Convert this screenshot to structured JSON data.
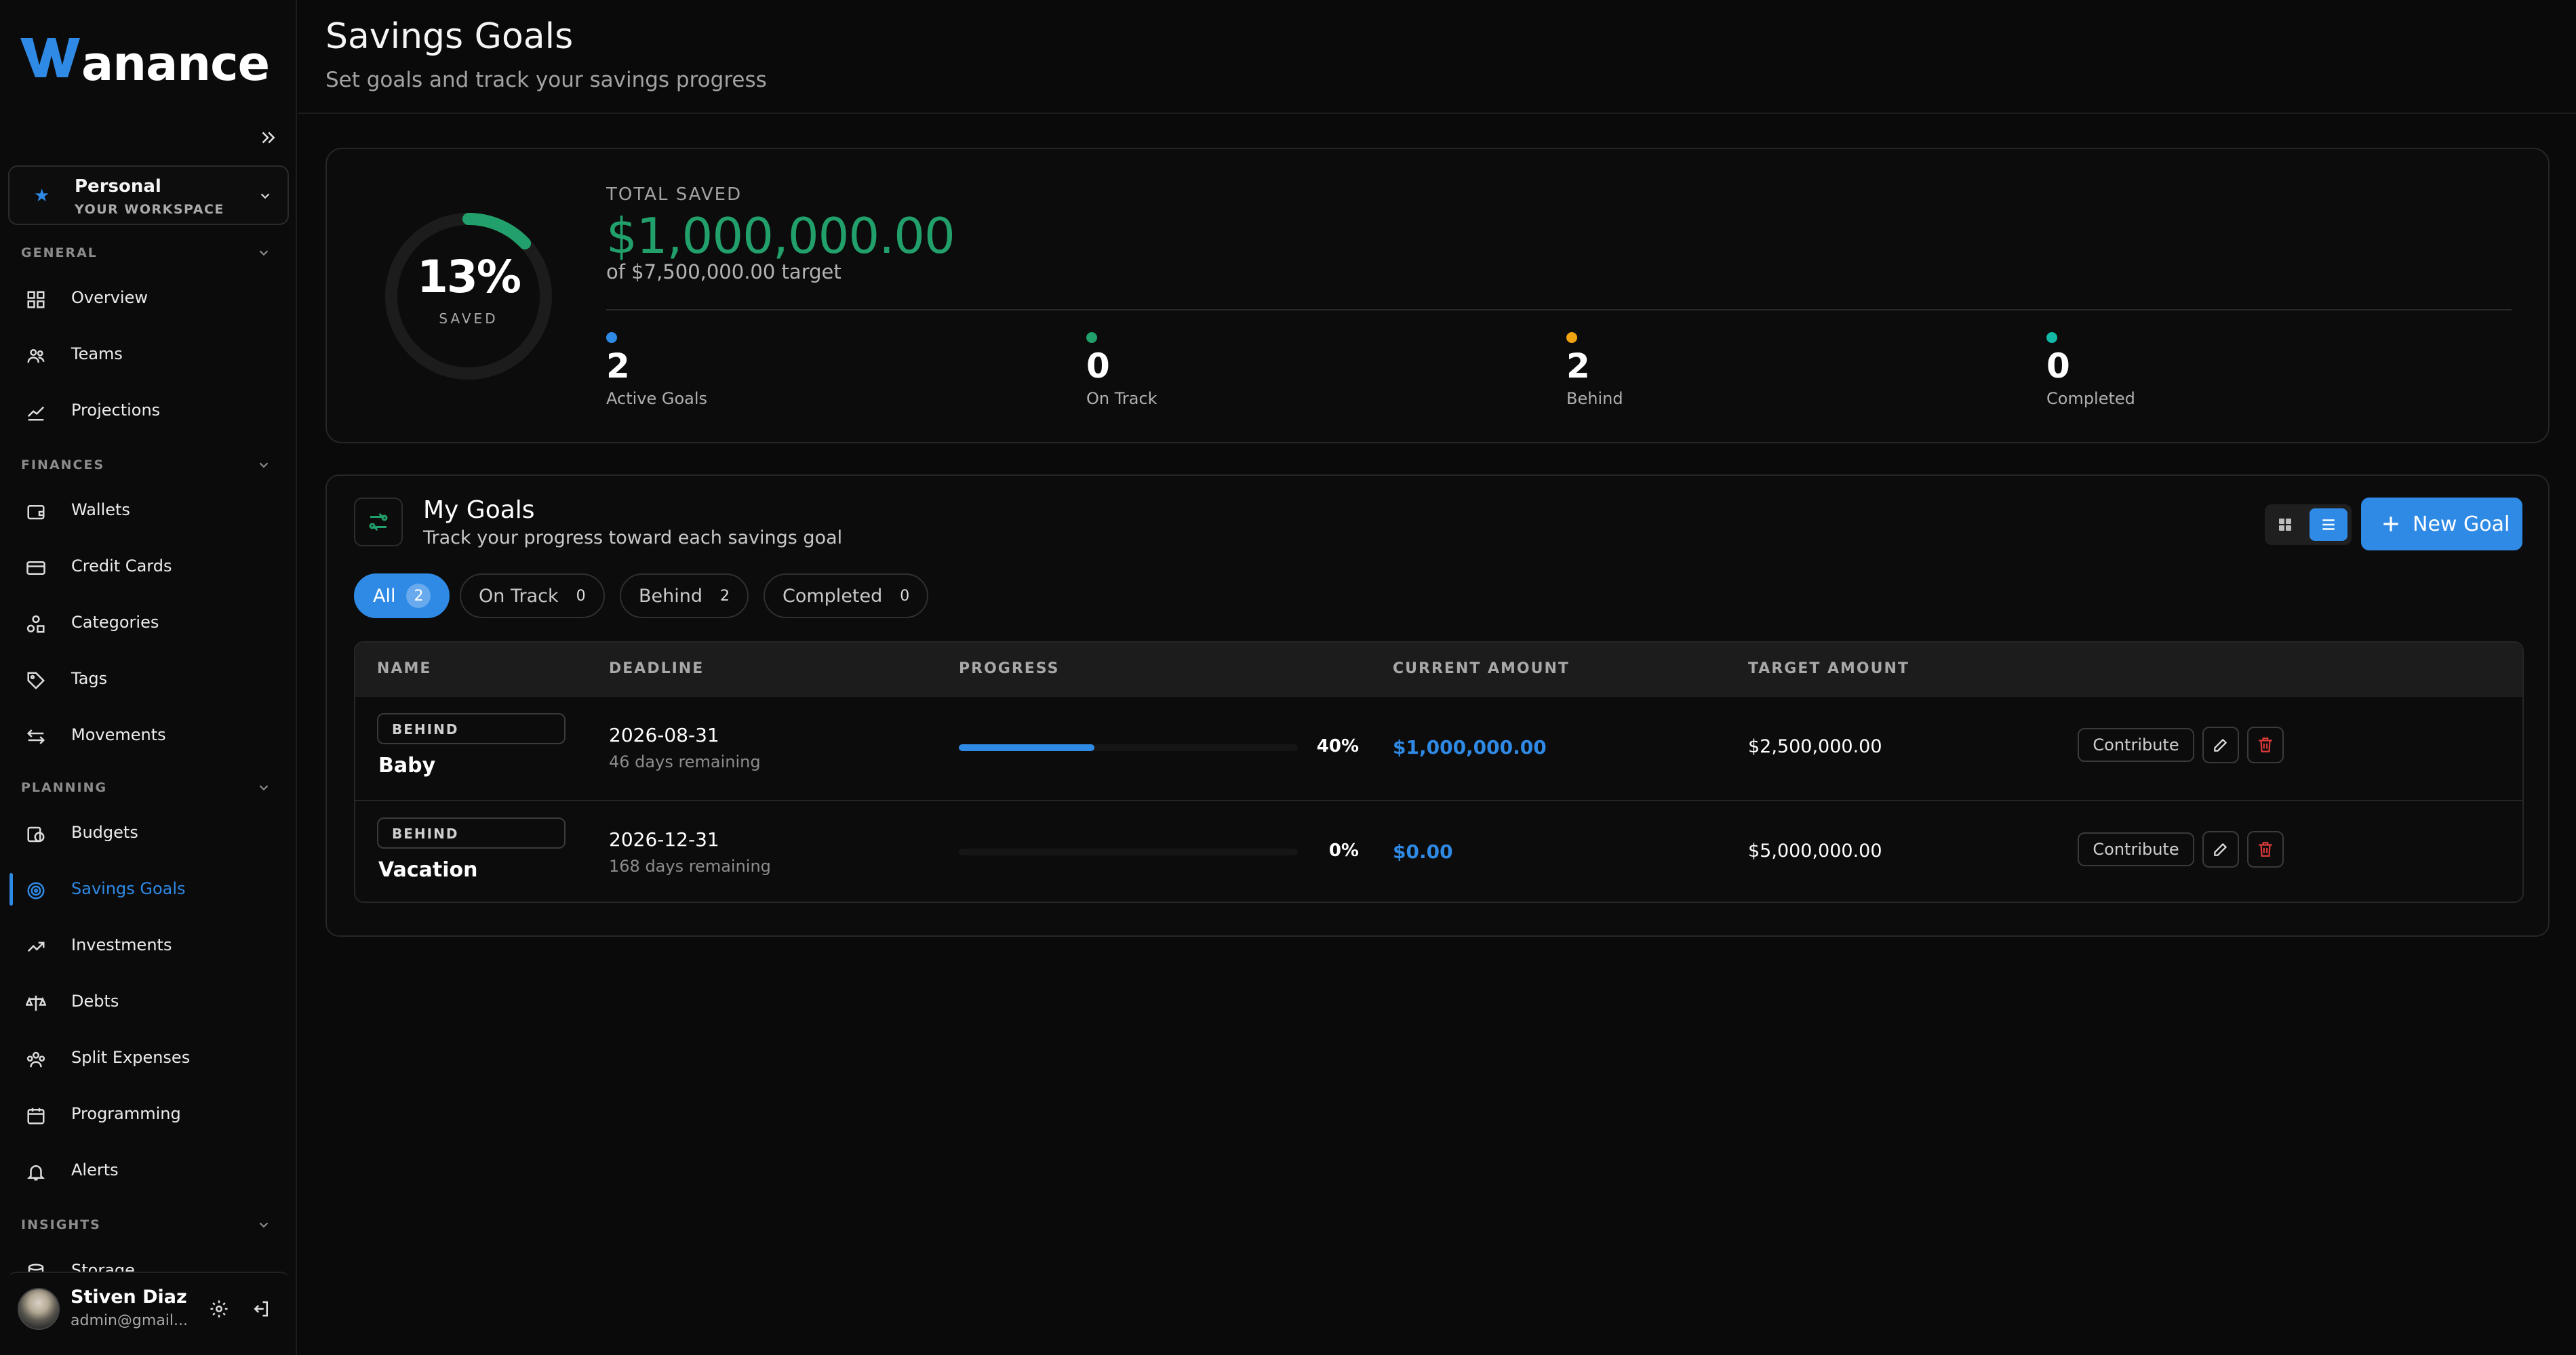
{
  "app": {
    "logo_text": "anance",
    "logo_mark": "W"
  },
  "workspace": {
    "name": "Personal",
    "subtitle": "YOUR WORKSPACE"
  },
  "sidebar": {
    "sections": {
      "general": "GENERAL",
      "finances": "FINANCES",
      "planning": "PLANNING",
      "insights": "INSIGHTS"
    },
    "items": {
      "overview": "Overview",
      "teams": "Teams",
      "projections": "Projections",
      "wallets": "Wallets",
      "credit_cards": "Credit Cards",
      "categories": "Categories",
      "tags": "Tags",
      "movements": "Movements",
      "budgets": "Budgets",
      "savings_goals": "Savings Goals",
      "investments": "Investments",
      "debts": "Debts",
      "split_expenses": "Split Expenses",
      "programming": "Programming",
      "alerts": "Alerts",
      "storage": "Storage"
    },
    "active_item": "savings_goals"
  },
  "user": {
    "name": "Stiven Diaz",
    "email": "admin@gmail..."
  },
  "header": {
    "title": "Savings Goals",
    "subtitle": "Set goals and track your savings progress"
  },
  "summary": {
    "percent_label": "13%",
    "percent_value": 0.13,
    "percent_caption": "SAVED",
    "total_label": "TOTAL SAVED",
    "total_amount": "$1,000,000.00",
    "target_text": "of $7,500,000.00 target",
    "stats": [
      {
        "value": "2",
        "label": "Active Goals",
        "color": "#2f8ae6"
      },
      {
        "value": "0",
        "label": "On Track",
        "color": "#22a06b"
      },
      {
        "value": "2",
        "label": "Behind",
        "color": "#f0a412"
      },
      {
        "value": "0",
        "label": "Completed",
        "color": "#14b8a6"
      }
    ]
  },
  "goals": {
    "title": "My Goals",
    "subtitle": "Track your progress toward each savings goal",
    "new_goal_label": "New Goal",
    "filters": [
      {
        "label": "All",
        "count": "2",
        "active": true
      },
      {
        "label": "On Track",
        "count": "0"
      },
      {
        "label": "Behind",
        "count": "2"
      },
      {
        "label": "Completed",
        "count": "0"
      }
    ],
    "columns": [
      "NAME",
      "DEADLINE",
      "PROGRESS",
      "CURRENT AMOUNT",
      "TARGET AMOUNT"
    ],
    "rows": [
      {
        "status": "BEHIND",
        "name": "Baby",
        "deadline": "2026-08-31",
        "remaining": "46 days remaining",
        "progress_label": "40%",
        "progress_value": 0.4,
        "current": "$1,000,000.00",
        "target": "$2,500,000.00",
        "contribute_label": "Contribute"
      },
      {
        "status": "BEHIND",
        "name": "Vacation",
        "deadline": "2026-12-31",
        "remaining": "168 days remaining",
        "progress_label": "0%",
        "progress_value": 0,
        "current": "$0.00",
        "target": "$5,000,000.00",
        "contribute_label": "Contribute"
      }
    ]
  }
}
